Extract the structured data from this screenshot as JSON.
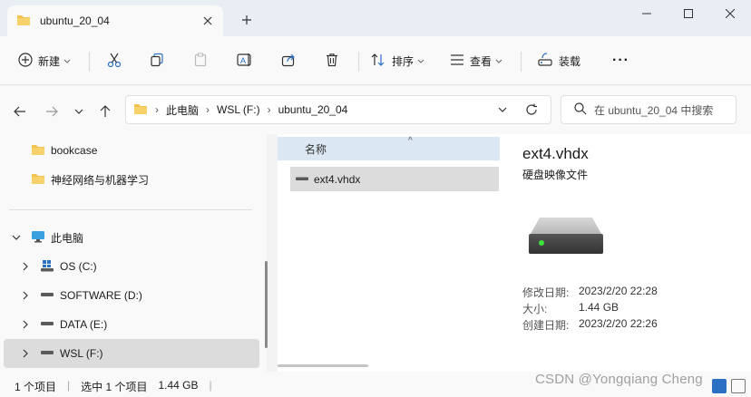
{
  "window": {
    "tab_title": "ubuntu_20_04",
    "new_tab": "+"
  },
  "toolbar": {
    "new_label": "新建",
    "sort_label": "排序",
    "view_label": "查看",
    "mount_label": "装载",
    "more_label": "···"
  },
  "address": {
    "crumbs": [
      "此电脑",
      "WSL (F:)",
      "ubuntu_20_04"
    ],
    "search_placeholder": "在 ubuntu_20_04 中搜索"
  },
  "nav": {
    "quick": [
      {
        "label": "bookcase"
      },
      {
        "label": "神经网络与机器学习"
      }
    ],
    "this_pc": "此电脑",
    "drives": [
      {
        "label": "OS (C:)",
        "icon": "windows-drive-icon"
      },
      {
        "label": "SOFTWARE (D:)",
        "icon": "drive-icon"
      },
      {
        "label": "DATA (E:)",
        "icon": "drive-icon"
      },
      {
        "label": "WSL (F:)",
        "icon": "drive-icon"
      }
    ]
  },
  "content": {
    "column_name": "名称",
    "files": [
      {
        "name": "ext4.vhdx"
      }
    ]
  },
  "details": {
    "title": "ext4.vhdx",
    "type": "硬盘映像文件",
    "rows": [
      {
        "label": "修改日期:",
        "value": "2023/2/20 22:28"
      },
      {
        "label": "大小:",
        "value": "1.44 GB"
      },
      {
        "label": "创建日期:",
        "value": "2023/2/20 22:26"
      }
    ]
  },
  "status": {
    "items": "1 个项目",
    "selected": "选中 1 个项目",
    "size": "1.44 GB"
  },
  "watermark": "CSDN @Yongqiang Cheng",
  "colors": {
    "folder": "#f2c14e",
    "selection": "#dcdcdc",
    "header": "#dbe7f2",
    "accent": "#2c70c4"
  }
}
